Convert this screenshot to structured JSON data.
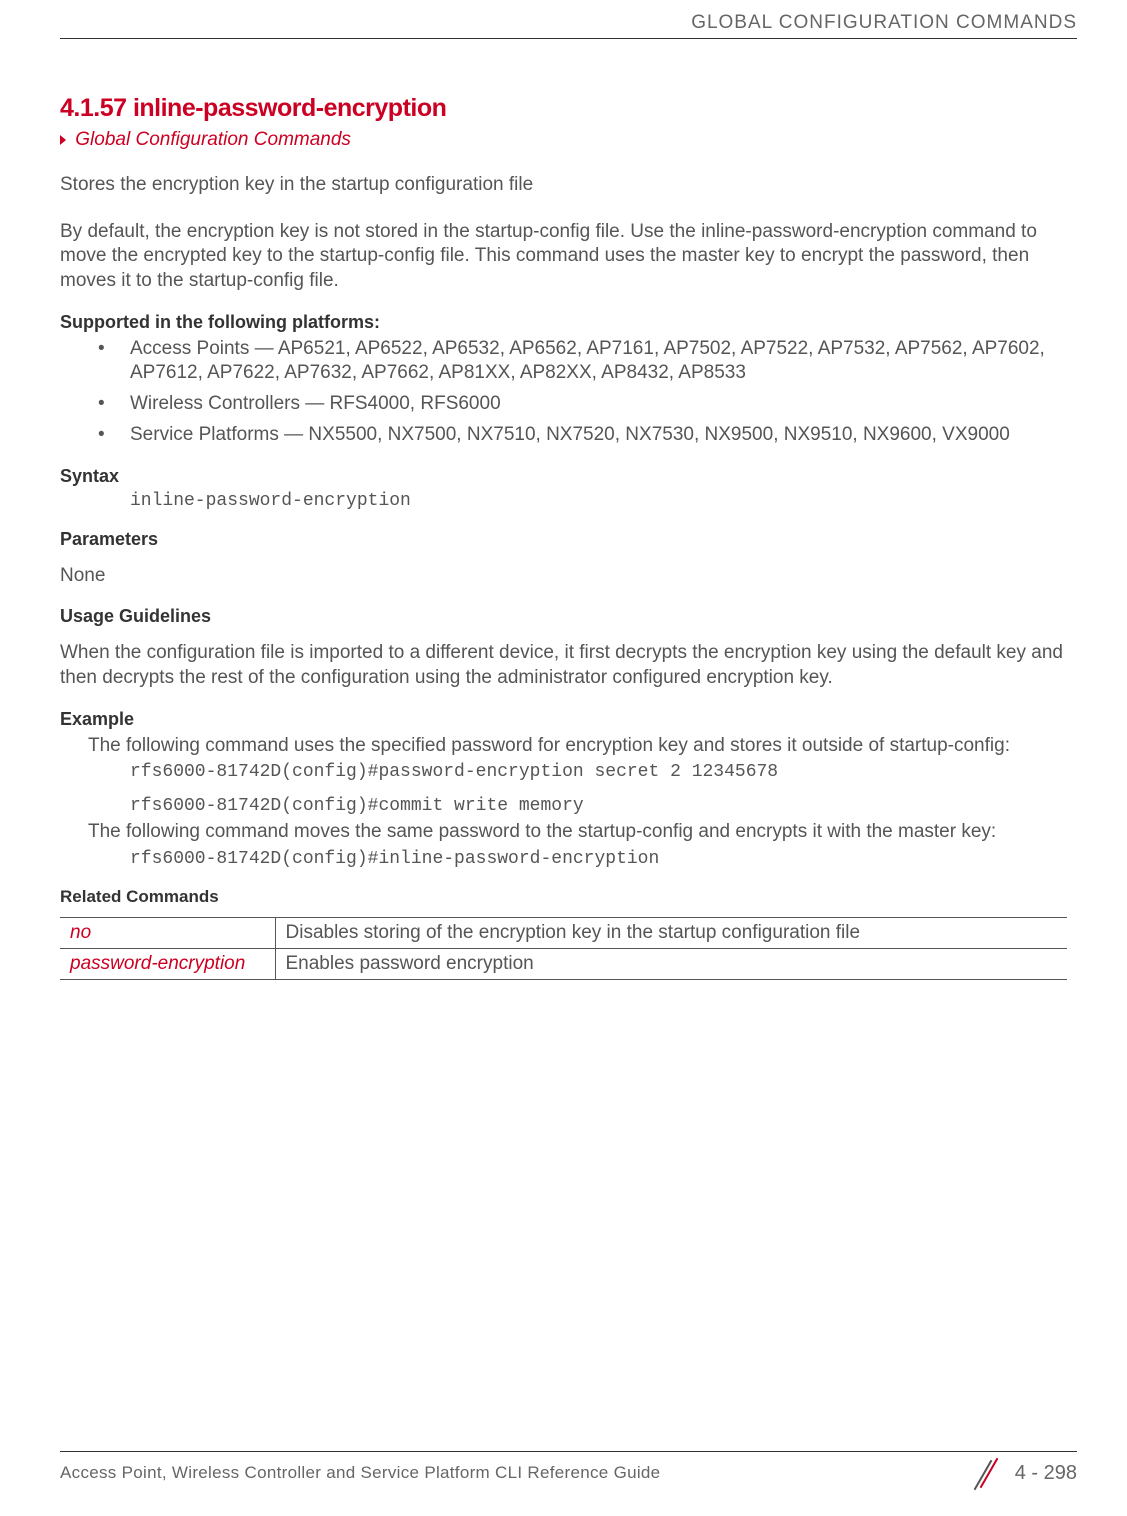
{
  "header": {
    "title": "GLOBAL CONFIGURATION COMMANDS"
  },
  "section": {
    "number_title": "4.1.57 inline-password-encryption",
    "breadcrumb": "Global Configuration Commands",
    "intro": "Stores the encryption key in the startup configuration file",
    "desc": "By default, the encryption key is not stored in the startup-config file. Use the inline-password-encryption command to move the encrypted key to the startup-config file. This command uses the master key to encrypt the password, then moves it to the startup-config file."
  },
  "supported": {
    "heading": "Supported in the following platforms:",
    "items": [
      "Access Points — AP6521, AP6522, AP6532, AP6562, AP7161, AP7502, AP7522, AP7532, AP7562, AP7602, AP7612, AP7622, AP7632, AP7662, AP81XX, AP82XX, AP8432, AP8533",
      "Wireless Controllers — RFS4000, RFS6000",
      "Service Platforms — NX5500, NX7500, NX7510, NX7520, NX7530, NX9500, NX9510, NX9600, VX9000"
    ]
  },
  "syntax": {
    "heading": "Syntax",
    "code": "inline-password-encryption"
  },
  "parameters": {
    "heading": "Parameters",
    "value": "None"
  },
  "usage": {
    "heading": "Usage Guidelines",
    "text": "When the configuration file is imported to a different device, it first decrypts the encryption key using the default key and then decrypts the rest of the configuration using the administrator configured encryption key."
  },
  "example": {
    "heading": "Example",
    "lead1": "The following command uses the specified password for encryption key and stores it outside of startup-config:",
    "code1": "rfs6000-81742D(config)#password-encryption secret 2 12345678",
    "code2": "rfs6000-81742D(config)#commit write memory",
    "lead2": "The following command moves the same password to the startup-config and encrypts it with the master key:",
    "code3": "rfs6000-81742D(config)#inline-password-encryption"
  },
  "related": {
    "heading": "Related Commands",
    "rows": [
      {
        "cmd": "no",
        "desc": "Disables storing of the encryption key in the startup configuration file"
      },
      {
        "cmd": "password-encryption",
        "desc": "Enables password encryption"
      }
    ]
  },
  "footer": {
    "left": "Access Point, Wireless Controller and Service Platform CLI Reference Guide",
    "page": "4 - 298"
  }
}
